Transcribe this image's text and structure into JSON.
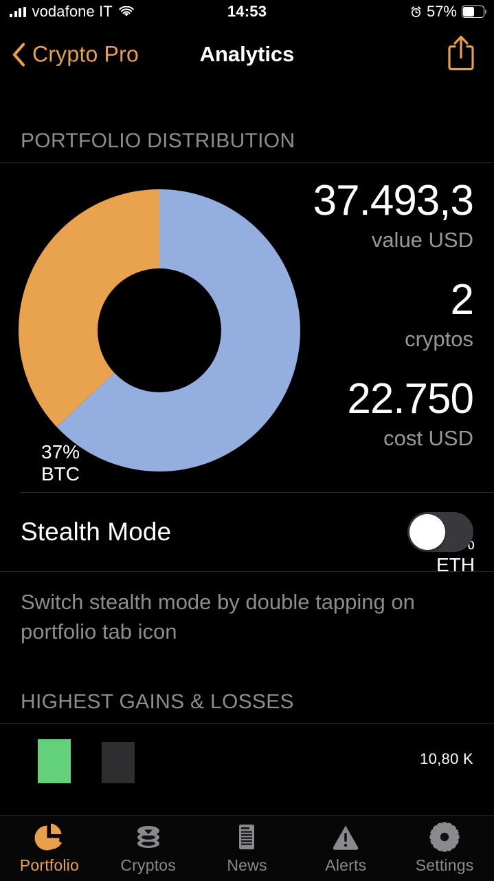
{
  "colors": {
    "accent": "#E8A04D",
    "btc_slice": "#E9A24E",
    "eth_slice": "#94AEE0",
    "gain_bar": "#63D17A",
    "loss_bar": "#2E2E30",
    "background": "#000000",
    "secondary_text": "#8D8D91",
    "switch_track": "#39393D"
  },
  "status_bar": {
    "carrier": "vodafone IT",
    "signal_icon": "cellular-signal-icon",
    "wifi_icon": "wifi-icon",
    "time": "14:53",
    "alarm_icon": "alarm-clock-icon",
    "battery_percent": "57%",
    "battery_level": 57,
    "battery_icon": "battery-icon"
  },
  "nav_bar": {
    "back_icon": "chevron-left-icon",
    "back_label": "Crypto Pro",
    "title": "Analytics",
    "share_icon": "share-icon"
  },
  "sections": {
    "distribution_header": "PORTFOLIO DISTRIBUTION",
    "gains_header": "HIGHEST GAINS & LOSSES"
  },
  "chart_data": {
    "type": "pie",
    "title": "PORTFOLIO DISTRIBUTION",
    "variant": "donut",
    "start_angle_deg": 0,
    "labels": [
      "ETH",
      "BTC"
    ],
    "values": [
      63,
      37
    ],
    "unit": "%",
    "colors": [
      "#94AEE0",
      "#E9A24E"
    ],
    "slice_labels": [
      {
        "percent": "63%",
        "symbol": "ETH"
      },
      {
        "percent": "37%",
        "symbol": "BTC"
      }
    ],
    "legend": "inline-on-slice"
  },
  "stats": [
    {
      "value": "37.493,3",
      "label": "value USD"
    },
    {
      "value": "2",
      "label": "cryptos"
    },
    {
      "value": "22.750",
      "label": "cost USD"
    }
  ],
  "stealth": {
    "label": "Stealth Mode",
    "enabled": false,
    "footnote": "Switch stealth mode by double tapping on portfolio tab icon"
  },
  "gains_chart": {
    "type": "bar",
    "categories": [
      "gain",
      "loss"
    ],
    "values": [
      10.8,
      10.1
    ],
    "value_axis_label": "10,80 K",
    "colors": [
      "#63D17A",
      "#2E2E30"
    ]
  },
  "tabs": [
    {
      "label": "Portfolio",
      "icon": "pie-chart-icon",
      "active": true
    },
    {
      "label": "Cryptos",
      "icon": "coins-stack-icon",
      "active": false
    },
    {
      "label": "News",
      "icon": "document-lines-icon",
      "active": false
    },
    {
      "label": "Alerts",
      "icon": "warning-triangle-icon",
      "active": false
    },
    {
      "label": "Settings",
      "icon": "gear-icon",
      "active": false
    }
  ]
}
